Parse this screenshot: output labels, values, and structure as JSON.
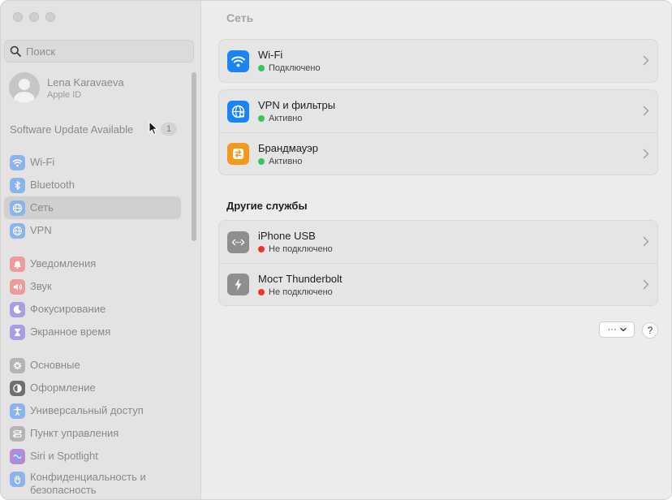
{
  "sidebar": {
    "search": {
      "placeholder": "Поиск",
      "value": ""
    },
    "account": {
      "name": "Lena Karavaeva",
      "subtitle": "Apple ID"
    },
    "software_update": {
      "label": "Software Update Available",
      "count": "1"
    },
    "items": [
      {
        "label": "Wi-Fi",
        "icon": "wifi-icon",
        "color": "#8bb4ef"
      },
      {
        "label": "Bluetooth",
        "icon": "bluetooth-icon",
        "color": "#8bb4ef"
      },
      {
        "label": "Сеть",
        "icon": "globe-icon",
        "color": "#8bb4ef"
      },
      {
        "label": "VPN",
        "icon": "vpn-globe-icon",
        "color": "#8bb4ef"
      },
      {
        "label": "Уведомления",
        "icon": "bell-icon",
        "color": "#ef9a9a"
      },
      {
        "label": "Звук",
        "icon": "speaker-icon",
        "color": "#ef9a9a"
      },
      {
        "label": "Фокусирование",
        "icon": "moon-icon",
        "color": "#a99ee6"
      },
      {
        "label": "Экранное время",
        "icon": "hourglass-icon",
        "color": "#a99ee6"
      },
      {
        "label": "Основные",
        "icon": "gear-icon",
        "color": "#b4b4b4"
      },
      {
        "label": "Оформление",
        "icon": "appearance-icon",
        "color": "#6f6f6f"
      },
      {
        "label": "Универсальный доступ",
        "icon": "accessibility-icon",
        "color": "#8bb4ef"
      },
      {
        "label": "Пункт управления",
        "icon": "control-center-icon",
        "color": "#b4b4b4"
      },
      {
        "label": "Siri и Spotlight",
        "icon": "siri-icon",
        "color": "#b48ad6"
      },
      {
        "label": "Конфиденциальность и безопасность",
        "icon": "hand-icon",
        "color": "#8bb4ef"
      }
    ],
    "selected": "Сеть"
  },
  "main": {
    "title": "Сеть",
    "group1": [
      {
        "title": "Wi-Fi",
        "status": "Подключено",
        "status_color": "#34c759",
        "icon": "wifi-icon",
        "icon_color": "#1a84f5"
      }
    ],
    "group2": [
      {
        "title": "VPN и фильтры",
        "status": "Активно",
        "status_color": "#34c759",
        "icon": "vpn-globe-icon",
        "icon_color": "#1a84f5"
      },
      {
        "title": "Брандмауэр",
        "status": "Активно",
        "status_color": "#34c759",
        "icon": "firewall-icon",
        "icon_color": "#f39a1e"
      }
    ],
    "other_services_title": "Другие службы",
    "group3": [
      {
        "title": "iPhone USB",
        "status": "Не подключено",
        "status_color": "#e8362e",
        "icon": "usb-arrows-icon",
        "icon_color": "#8e8e8e"
      },
      {
        "title": "Мост Thunderbolt",
        "status": "Не подключено",
        "status_color": "#e8362e",
        "icon": "thunderbolt-icon",
        "icon_color": "#8e8e8e"
      }
    ],
    "more_button": "···",
    "help_button": "?"
  }
}
